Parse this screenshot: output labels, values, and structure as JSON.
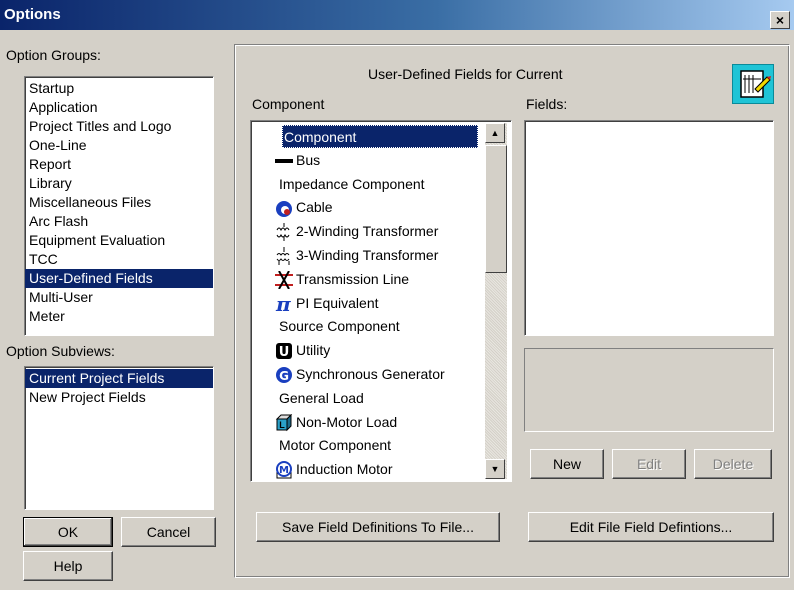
{
  "window": {
    "title": "Options",
    "close_glyph": "×"
  },
  "left": {
    "option_groups_label": "Option Groups:",
    "option_groups": [
      "Startup",
      "Application",
      "Project Titles and Logo",
      "One-Line",
      "Report",
      "Library",
      "Miscellaneous Files",
      "Arc Flash",
      "Equipment Evaluation",
      "TCC",
      "User-Defined Fields",
      "Multi-User",
      "Meter"
    ],
    "option_groups_selected": "User-Defined Fields",
    "subviews_label": "Option Subviews:",
    "subviews": [
      "Current Project Fields",
      "New Project Fields"
    ],
    "subviews_selected": "Current Project Fields",
    "ok_label": "OK",
    "cancel_label": "Cancel",
    "help_label": "Help"
  },
  "right": {
    "header": "User-Defined Fields for Current",
    "component_label": "Component",
    "fields_label": "Fields:",
    "component_items": [
      {
        "label": "Component",
        "icon": "none",
        "selected": true
      },
      {
        "label": "Bus",
        "icon": "bus-icon"
      },
      {
        "label": "Impedance Component",
        "icon": "none"
      },
      {
        "label": "Cable",
        "icon": "cable-icon"
      },
      {
        "label": "2-Winding Transformer",
        "icon": "transformer-2w-icon"
      },
      {
        "label": "3-Winding Transformer",
        "icon": "transformer-3w-icon"
      },
      {
        "label": "Transmission Line",
        "icon": "transmission-line-icon"
      },
      {
        "label": "PI Equivalent",
        "icon": "pi-icon"
      },
      {
        "label": "Source Component",
        "icon": "none"
      },
      {
        "label": "Utility",
        "icon": "utility-icon"
      },
      {
        "label": "Synchronous Generator",
        "icon": "generator-icon"
      },
      {
        "label": "General Load",
        "icon": "none"
      },
      {
        "label": "Non-Motor Load",
        "icon": "load-icon"
      },
      {
        "label": "Motor Component",
        "icon": "none"
      },
      {
        "label": "Induction Motor",
        "icon": "motor-icon"
      }
    ],
    "new_label": "New",
    "edit_label": "Edit",
    "delete_label": "Delete",
    "save_defs_label": "Save Field Definitions To File...",
    "edit_file_defs_label": "Edit File Field Defintions..."
  }
}
